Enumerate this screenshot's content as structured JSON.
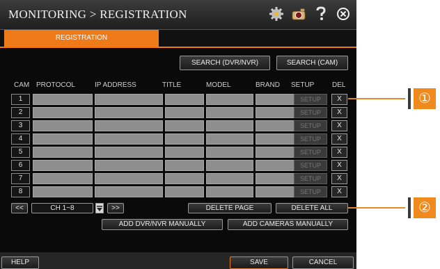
{
  "window": {
    "title": "MONITORING > REGISTRATION",
    "icons": [
      "gear-icon",
      "camera-icon",
      "help-icon",
      "close-icon"
    ]
  },
  "tab": {
    "label": "REGISTRATION"
  },
  "search": {
    "dvr_nvr": "SEARCH (DVR/NVR)",
    "cam": "SEARCH (CAM)"
  },
  "columns": [
    "CAM",
    "PROTOCOL",
    "IP ADDRESS",
    "TITLE",
    "MODEL",
    "BRAND",
    "SETUP",
    "DEL"
  ],
  "rows": [
    {
      "cam": "1",
      "setup": "SETUP",
      "del": "X"
    },
    {
      "cam": "2",
      "setup": "SETUP",
      "del": "X"
    },
    {
      "cam": "3",
      "setup": "SETUP",
      "del": "X"
    },
    {
      "cam": "4",
      "setup": "SETUP",
      "del": "X"
    },
    {
      "cam": "5",
      "setup": "SETUP",
      "del": "X"
    },
    {
      "cam": "6",
      "setup": "SETUP",
      "del": "X"
    },
    {
      "cam": "7",
      "setup": "SETUP",
      "del": "X"
    },
    {
      "cam": "8",
      "setup": "SETUP",
      "del": "X"
    }
  ],
  "pager": {
    "prev": "<<",
    "channel": "CH 1~8",
    "next": ">>"
  },
  "actions": {
    "delete_page": "DELETE PAGE",
    "delete_all": "DELETE ALL",
    "add_dvr_nvr": "ADD DVR/NVR MANUALLY",
    "add_cameras": "ADD CAMERAS MANUALLY"
  },
  "footer": {
    "help": "HELP",
    "save": "SAVE",
    "cancel": "CANCEL"
  },
  "callouts": [
    "①",
    "②"
  ],
  "colors": {
    "accent": "#ef7a1a",
    "callout": "#f08a1c"
  }
}
